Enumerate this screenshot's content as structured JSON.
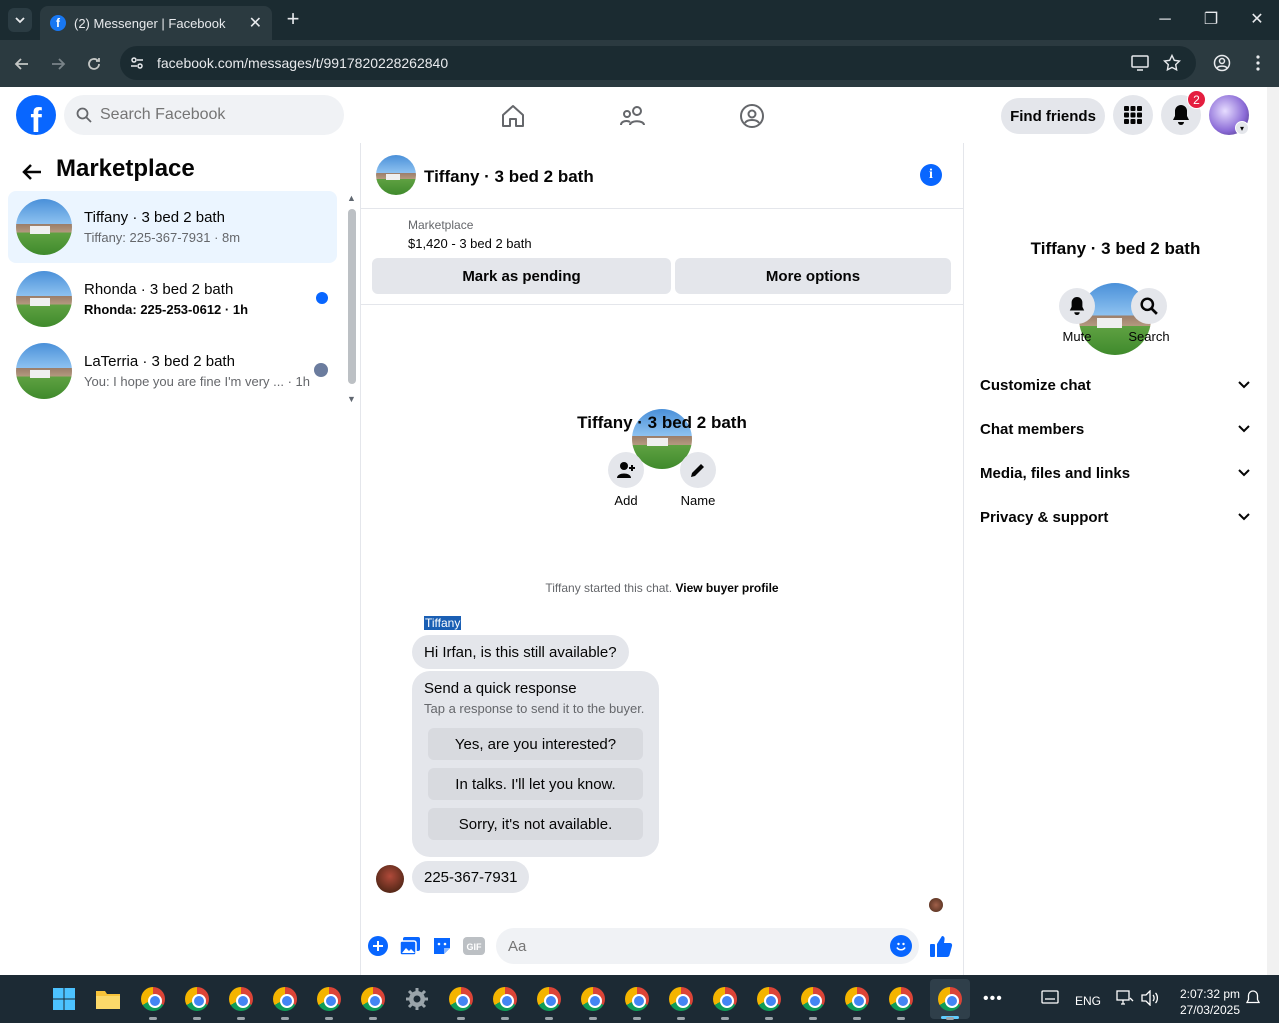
{
  "browser": {
    "tab_title": "(2) Messenger | Facebook",
    "url": "facebook.com/messages/t/9917820228262840"
  },
  "header": {
    "search_placeholder": "Search Facebook",
    "find_friends": "Find friends",
    "notif_count": "2",
    "brand_color": "#0866ff"
  },
  "left": {
    "title": "Marketplace",
    "conversations": [
      {
        "name": "Tiffany · 3 bed 2 bath",
        "preview": "Tiffany: 225-367-7931 · 8m",
        "selected": true
      },
      {
        "name": "Rhonda · 3 bed 2 bath",
        "preview": "Rhonda: 225-253-0612 · 1h",
        "unread": true
      },
      {
        "name": "LaTerria · 3 bed 2 bath",
        "preview": "You: I hope you are fine I'm very ... · 1h"
      }
    ]
  },
  "chat": {
    "title": "Tiffany · 3 bed 2 bath",
    "marketplace_label": "Marketplace",
    "price_line": "$1,420 - 3 bed 2 bath",
    "mark_pending": "Mark as pending",
    "more_options": "More options",
    "center_name": "Tiffany · 3 bed 2 bath",
    "add_label": "Add",
    "name_label": "Name",
    "started_text": "Tiffany started this chat.",
    "view_profile": "View buyer profile",
    "sender": "Tiffany",
    "message1": "Hi Irfan, is this still available?",
    "quick_title": "Send a quick response",
    "quick_sub": "Tap a response to send it to the buyer.",
    "quick_replies": [
      "Yes, are you interested?",
      "In talks. I'll let you know.",
      "Sorry, it's not available."
    ],
    "message2": "225-367-7931",
    "composer_placeholder": "Aa"
  },
  "right": {
    "name": "Tiffany · 3 bed 2 bath",
    "mute": "Mute",
    "search": "Search",
    "sections": [
      "Customize chat",
      "Chat members",
      "Media, files and links",
      "Privacy & support"
    ]
  },
  "taskbar": {
    "lang": "ENG",
    "time": "2:07:32 pm",
    "date": "27/03/2025"
  }
}
